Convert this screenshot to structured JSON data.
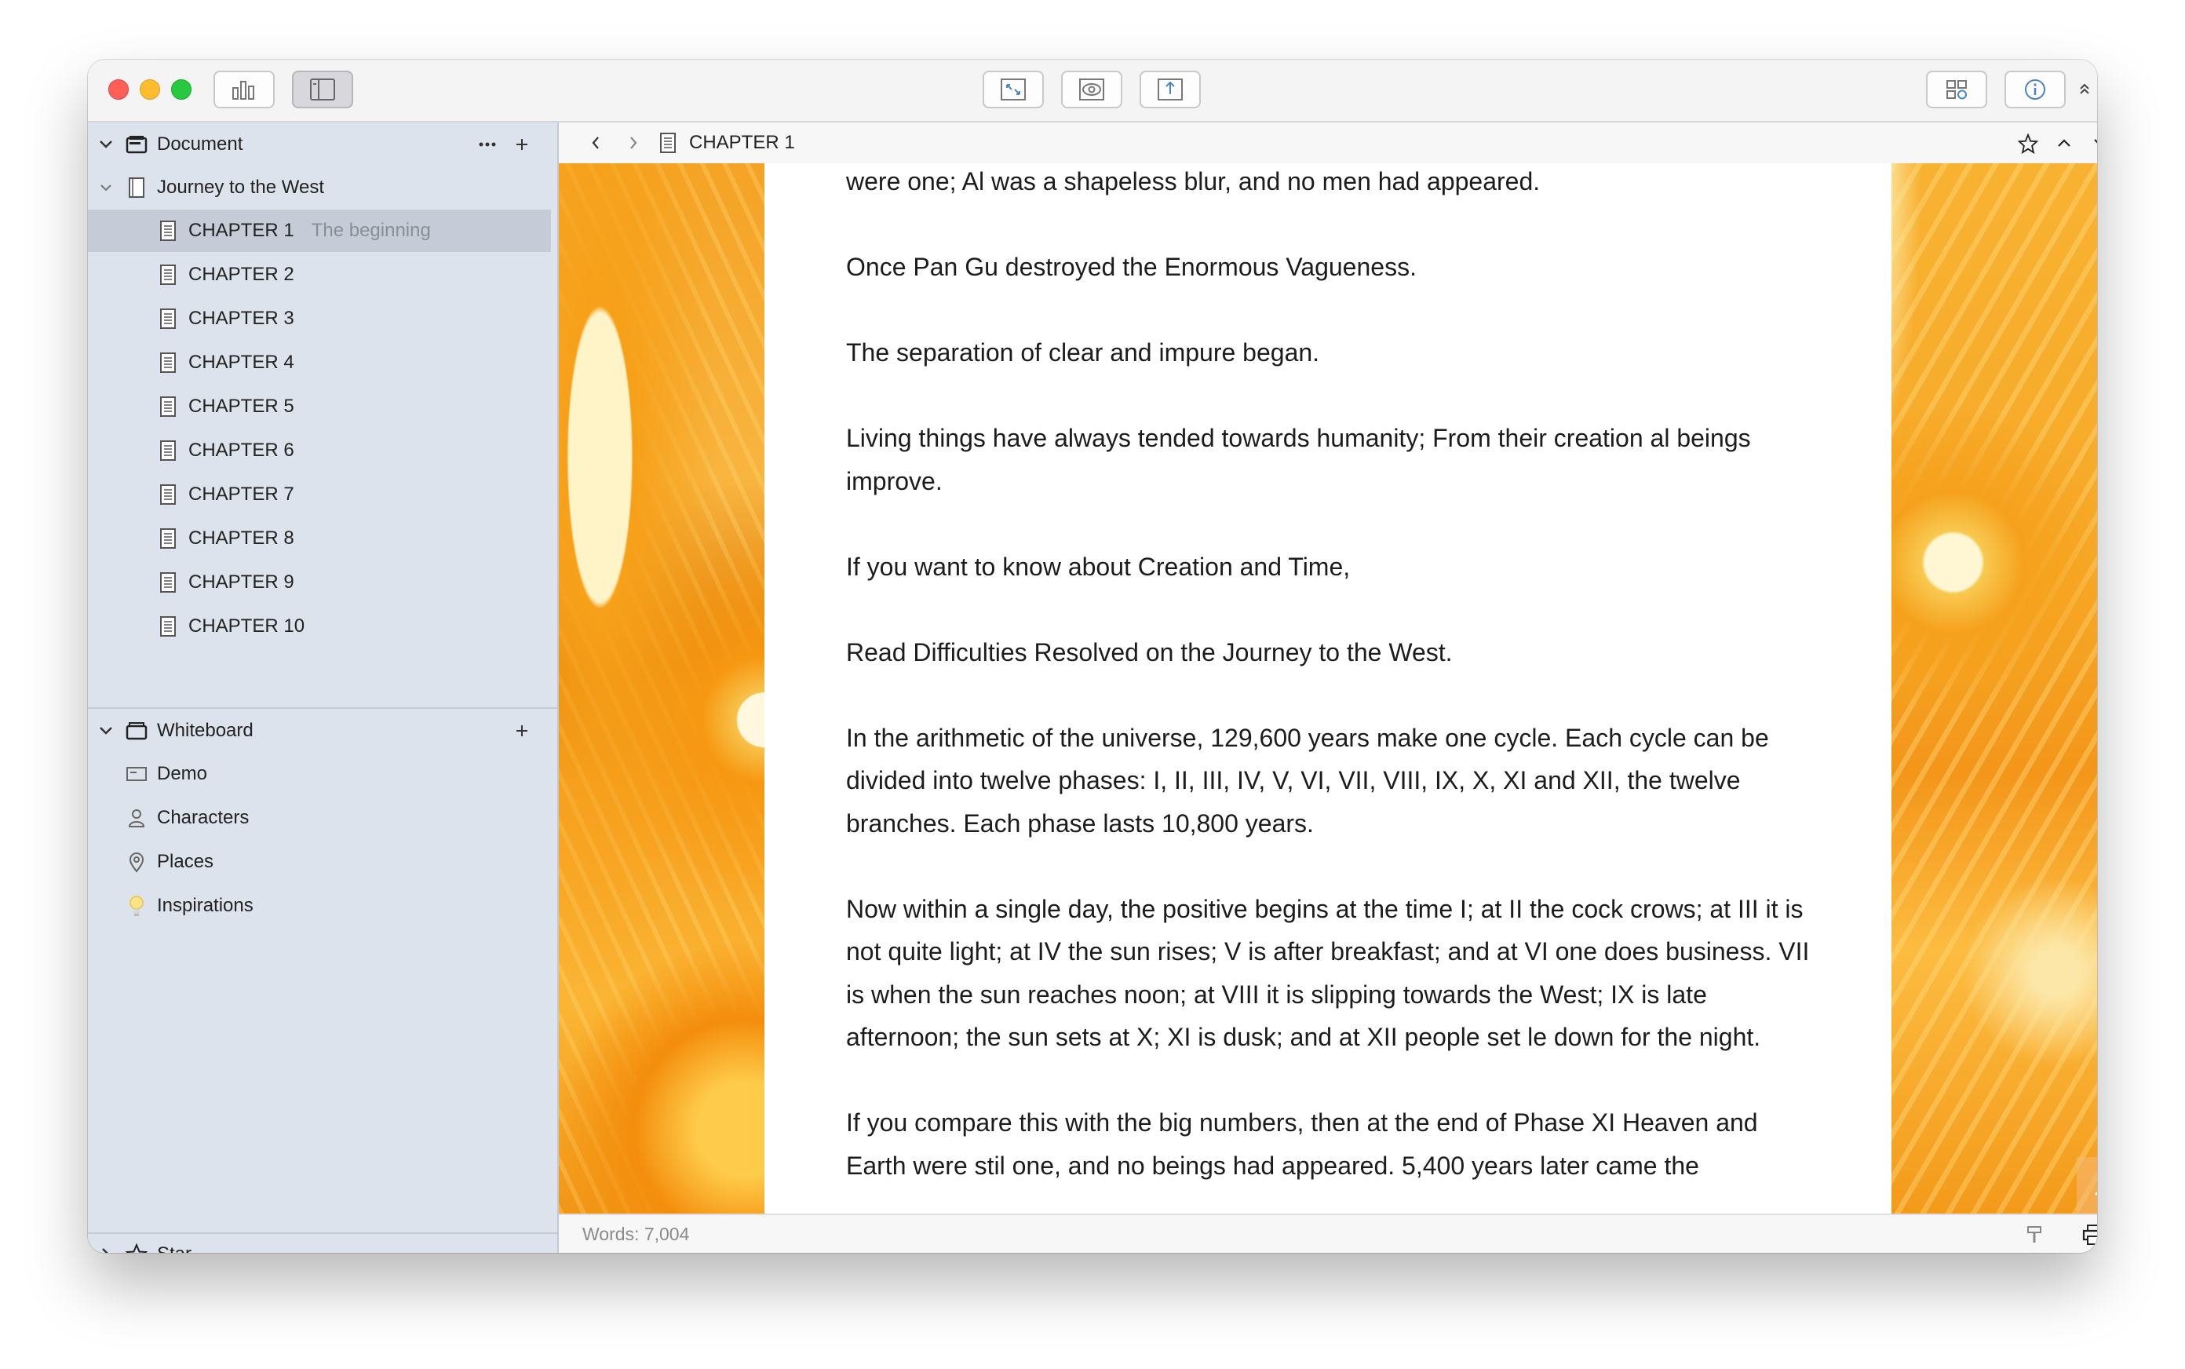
{
  "window": {
    "toolbar": {
      "stats_icon": "bar-chart-icon",
      "sidebar_toggle_icon": "sidebar-icon",
      "focus_icon": "expand-icon",
      "preview_icon": "eye-icon",
      "share_icon": "share-icon",
      "grid_icon": "grid-icon",
      "info_icon": "info-icon"
    }
  },
  "sidebar": {
    "document_section": {
      "label": "Document"
    },
    "project": {
      "label": "Journey to the West"
    },
    "chapters": [
      {
        "label": "CHAPTER 1",
        "subtitle": "The beginning"
      },
      {
        "label": "CHAPTER 2"
      },
      {
        "label": "CHAPTER 3"
      },
      {
        "label": "CHAPTER 4"
      },
      {
        "label": "CHAPTER 5"
      },
      {
        "label": "CHAPTER 6"
      },
      {
        "label": "CHAPTER 7"
      },
      {
        "label": "CHAPTER 8"
      },
      {
        "label": "CHAPTER 9"
      },
      {
        "label": "CHAPTER 10"
      }
    ],
    "whiteboard_section": {
      "label": "Whiteboard"
    },
    "whiteboard_items": [
      {
        "label": "Demo",
        "icon": "card-icon"
      },
      {
        "label": "Characters",
        "icon": "person-icon"
      },
      {
        "label": "Places",
        "icon": "location-pin-icon"
      },
      {
        "label": "Inspirations",
        "icon": "lightbulb-icon"
      }
    ],
    "star_section": {
      "label": "Star"
    }
  },
  "editor": {
    "breadcrumb": "CHAPTER 1",
    "paragraphs": [
      "were one; Al was a shapeless blur, and no men had appeared.",
      "Once Pan Gu destroyed the Enormous Vagueness.",
      "The separation of clear and impure began.",
      "Living things have always tended towards humanity; From their creation al beings improve.",
      "If you want to know about Creation and Time,",
      "Read Difficulties Resolved on the Journey to the West.",
      "In the arithmetic of the universe, 129,600 years make one cycle. Each cycle can be divided into twelve phases: I, II, III, IV, V, VI, VII, VIII, IX, X, XI and XII, the twelve branches. Each phase lasts 10,800 years.",
      "Now within a single day, the positive begins at the time I; at II the cock crows; at III it is not quite light; at IV the sun rises; V is after breakfast; and at VI one does business. VII is when the sun reaches noon; at VIII it is slipping towards the West; IX is late afternoon; the sun sets at X; XI is dusk; and at XII people set le down for the night.",
      "If you compare this with the big numbers, then at the end of Phase XI Heaven and Earth were stil one, and no beings had appeared. 5,400 years later came the"
    ]
  },
  "statusbar": {
    "words": "Words: 7,004"
  },
  "colors": {
    "sidebar_bg": "#dde3ec",
    "selected_row": "#c5ccd8",
    "accent_orange": "#f9a11f"
  }
}
